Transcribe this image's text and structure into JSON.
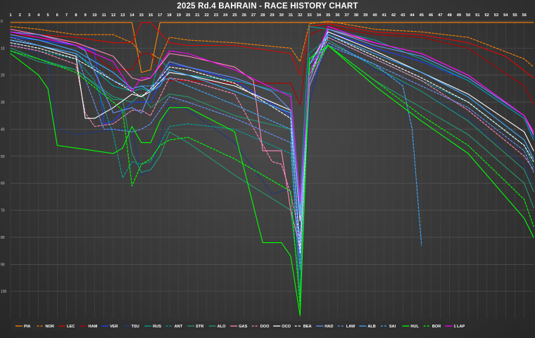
{
  "page": {
    "title": "2025 Rd.4 BAHRAIN - RACE HISTORY CHART"
  },
  "chart_data": {
    "type": "line",
    "title": "2025 Rd.4 BAHRAIN - RACE HISTORY CHART",
    "xlabel": "",
    "ylabel": "",
    "x_ticks": [
      1,
      2,
      3,
      4,
      5,
      6,
      7,
      8,
      9,
      10,
      11,
      12,
      13,
      14,
      15,
      16,
      17,
      18,
      19,
      20,
      21,
      22,
      23,
      24,
      25,
      26,
      27,
      28,
      29,
      30,
      31,
      32,
      33,
      34,
      35,
      36,
      37,
      38,
      39,
      40,
      41,
      42,
      43,
      44,
      45,
      46,
      47,
      48,
      49,
      50,
      51,
      52,
      53,
      54,
      55,
      56
    ],
    "xlim": [
      1,
      57
    ],
    "ylim": [
      0,
      110
    ],
    "y_ticks": [
      0,
      10,
      20,
      30,
      40,
      50,
      60,
      70,
      80,
      90,
      100
    ],
    "y_tick_labels": [
      "0",
      "10",
      "20",
      "30",
      "40",
      "50",
      "60",
      "70",
      "80",
      "90",
      "100"
    ],
    "grid": true,
    "legend_position": "bottom",
    "series": [
      {
        "name": "PIA",
        "color": "#ff8000",
        "dash": "solid",
        "x": [
          1,
          4,
          8,
          12,
          13,
          14,
          15,
          16,
          17,
          18,
          20,
          25,
          31,
          32,
          33,
          35,
          40,
          45,
          50,
          56,
          57
        ],
        "y": [
          0.5,
          0.5,
          0.5,
          0.5,
          0.5,
          0.5,
          19,
          18,
          0.5,
          0.5,
          0.5,
          0.5,
          0.5,
          0.5,
          0.5,
          0.5,
          0.5,
          0.5,
          0.5,
          0.5,
          0.5
        ]
      },
      {
        "name": "NOR",
        "color": "#ff8000",
        "dash": "dash",
        "x": [
          1,
          4,
          8,
          12,
          14,
          15,
          16,
          17,
          18,
          20,
          25,
          31,
          32,
          33,
          35,
          40,
          45,
          50,
          56,
          57
        ],
        "y": [
          2,
          3,
          5,
          5,
          8,
          12,
          12,
          14,
          6,
          7,
          8,
          10,
          15,
          1,
          0,
          3,
          4,
          6,
          14,
          17
        ]
      },
      {
        "name": "LEC",
        "color": "#e10600",
        "dash": "solid",
        "x": [
          1,
          4,
          8,
          12,
          14,
          15,
          16,
          18,
          20,
          25,
          31,
          32,
          33,
          35,
          40,
          45,
          50,
          54,
          57
        ],
        "y": [
          3,
          5,
          6,
          8,
          8,
          0.5,
          0.5,
          8,
          9,
          9,
          12,
          20,
          2,
          1,
          4,
          5,
          8,
          13,
          21
        ]
      },
      {
        "name": "HAM",
        "color": "#b00000",
        "dash": "solid",
        "x": [
          1,
          4,
          8,
          12,
          14,
          15,
          16,
          18,
          20,
          25,
          31,
          32,
          33,
          35,
          40,
          45,
          50,
          56,
          57
        ],
        "y": [
          5,
          6,
          8,
          18,
          18,
          12,
          12,
          22,
          22,
          23,
          23,
          31,
          5,
          2,
          5,
          6,
          10,
          24,
          31
        ]
      },
      {
        "name": "VER",
        "color": "#1e41ff",
        "dash": "solid",
        "x": [
          1,
          4,
          8,
          9,
          10,
          11,
          12,
          14,
          15,
          16,
          18,
          20,
          25,
          31,
          32,
          33,
          35,
          40,
          45,
          50,
          56,
          57
        ],
        "y": [
          6,
          7,
          9,
          10,
          11,
          38,
          37,
          30,
          30,
          30,
          16,
          17,
          22,
          35,
          90,
          30,
          4,
          10,
          15,
          22,
          36,
          43
        ]
      },
      {
        "name": "TSU",
        "color": "#20397a",
        "dash": "solid",
        "x": [
          1,
          4,
          5,
          6,
          8,
          12,
          14,
          15,
          16,
          17,
          18,
          20,
          25,
          29,
          30,
          31,
          32,
          33,
          35,
          40,
          45,
          50,
          56,
          57
        ],
        "y": [
          8,
          12,
          15,
          40,
          42,
          40,
          40,
          57,
          55,
          44,
          30,
          33,
          45,
          64,
          63,
          62,
          96,
          30,
          5,
          18,
          26,
          36,
          53,
          61
        ]
      },
      {
        "name": "RUS",
        "color": "#00a19c",
        "dash": "solid",
        "x": [
          1,
          4,
          8,
          12,
          14,
          15,
          16,
          17,
          18,
          20,
          25,
          31,
          32,
          33,
          35,
          40,
          45,
          50,
          56,
          57
        ],
        "y": [
          7,
          9,
          12,
          24,
          26,
          25,
          26,
          14,
          18,
          20,
          22,
          27,
          66,
          2,
          3,
          7,
          14,
          22,
          36,
          44
        ]
      },
      {
        "name": "ANT",
        "color": "#00a19c",
        "dash": "dash",
        "x": [
          1,
          4,
          8,
          10,
          12,
          13,
          14,
          15,
          16,
          18,
          20,
          25,
          31,
          32,
          33,
          35,
          40,
          45,
          50,
          56,
          57
        ],
        "y": [
          9,
          11,
          14,
          22,
          42,
          58,
          52,
          53,
          52,
          39,
          38,
          40,
          49,
          92,
          12,
          6,
          14,
          22,
          30,
          46,
          54
        ]
      },
      {
        "name": "STR",
        "color": "#229971",
        "dash": "solid",
        "x": [
          1,
          4,
          8,
          12,
          13,
          14,
          15,
          16,
          17,
          18,
          20,
          25,
          31,
          32,
          33,
          35,
          40,
          45,
          50,
          56,
          57
        ],
        "y": [
          10,
          14,
          18,
          29,
          29,
          49,
          56,
          55,
          50,
          41,
          45,
          57,
          70,
          100,
          14,
          7,
          17,
          26,
          37,
          55,
          63
        ]
      },
      {
        "name": "ALO",
        "color": "#229971",
        "dash": "solid",
        "x": [
          1,
          4,
          8,
          12,
          14,
          15,
          16,
          18,
          20,
          25,
          31,
          32,
          33,
          35,
          40,
          45,
          50,
          56,
          57
        ],
        "y": [
          11,
          15,
          18,
          28,
          30,
          27,
          32,
          27,
          28,
          35,
          40,
          104,
          18,
          9,
          22,
          32,
          42,
          60,
          69
        ]
      },
      {
        "name": "GAS",
        "color": "#ff87bc",
        "dash": "solid",
        "x": [
          1,
          4,
          8,
          12,
          14,
          15,
          16,
          18,
          20,
          25,
          27,
          28,
          29,
          30,
          31,
          32,
          33,
          35,
          40,
          45,
          50,
          56,
          57
        ],
        "y": [
          3,
          5,
          8,
          13,
          21,
          22,
          21,
          12,
          13,
          17,
          22,
          48,
          48,
          48,
          70,
          84,
          22,
          3,
          8,
          12,
          20,
          35,
          42
        ]
      },
      {
        "name": "DOO",
        "color": "#ff87bc",
        "dash": "dash",
        "x": [
          1,
          4,
          8,
          9,
          10,
          12,
          14,
          15,
          16,
          18,
          20,
          25,
          29,
          30,
          31,
          32,
          33,
          35,
          40,
          45,
          50,
          56,
          57
        ],
        "y": [
          9,
          11,
          16,
          34,
          39,
          38,
          33,
          33,
          35,
          21,
          22,
          27,
          52,
          53,
          64,
          80,
          24,
          6,
          14,
          22,
          33,
          50,
          55
        ]
      },
      {
        "name": "OCO",
        "color": "#ffffff",
        "dash": "solid",
        "x": [
          1,
          4,
          8,
          9,
          10,
          12,
          14,
          15,
          16,
          18,
          20,
          25,
          31,
          32,
          33,
          35,
          40,
          45,
          50,
          56,
          57
        ],
        "y": [
          7,
          9,
          13,
          36,
          36,
          32,
          27,
          28,
          26,
          19,
          20,
          24,
          33,
          74,
          16,
          4,
          11,
          19,
          27,
          41,
          48
        ]
      },
      {
        "name": "BEA",
        "color": "#ffffff",
        "dash": "dash",
        "x": [
          1,
          4,
          8,
          12,
          14,
          15,
          16,
          18,
          20,
          25,
          31,
          32,
          33,
          35,
          40,
          45,
          50,
          56,
          57
        ],
        "y": [
          8,
          10,
          14,
          22,
          26,
          28,
          25,
          17,
          18,
          23,
          36,
          86,
          20,
          5,
          13,
          21,
          30,
          46,
          52
        ]
      },
      {
        "name": "HAD",
        "color": "#6692ff",
        "dash": "solid",
        "x": [
          1,
          4,
          8,
          9,
          12,
          14,
          15,
          16,
          18,
          20,
          25,
          29,
          31,
          32,
          33,
          35,
          40,
          45,
          50,
          56,
          57
        ],
        "y": [
          4,
          5,
          9,
          11,
          34,
          32,
          34,
          26,
          15,
          17,
          21,
          26,
          33,
          70,
          22,
          3,
          9,
          13,
          21,
          35,
          41
        ]
      },
      {
        "name": "LAW",
        "color": "#6692ff",
        "dash": "dash",
        "x": [
          1,
          4,
          8,
          11,
          12,
          14,
          15,
          16,
          18,
          20,
          25,
          31,
          32,
          33,
          35,
          40,
          45,
          50,
          56,
          57
        ],
        "y": [
          6,
          9,
          12,
          40,
          40,
          41,
          40,
          38,
          28,
          30,
          36,
          45,
          92,
          24,
          8,
          16,
          24,
          32,
          48,
          56
        ]
      },
      {
        "name": "ALB",
        "color": "#3fa9ff",
        "dash": "solid",
        "x": [
          1,
          4,
          8,
          12,
          14,
          15,
          16,
          17,
          18,
          20,
          25,
          31,
          32,
          33,
          35,
          40,
          45,
          50,
          56,
          57
        ],
        "y": [
          5,
          7,
          11,
          19,
          25,
          24,
          26,
          24,
          18,
          20,
          26,
          34,
          72,
          16,
          5,
          12,
          19,
          28,
          44,
          51
        ]
      },
      {
        "name": "SAI",
        "color": "#3fa9ff",
        "dash": "dash",
        "x": [
          1,
          4,
          8,
          12,
          14,
          15,
          16,
          18,
          20,
          25,
          31,
          32,
          33,
          35,
          40,
          43,
          44,
          45
        ],
        "y": [
          7,
          9,
          12,
          22,
          25,
          24,
          24,
          21,
          24,
          31,
          40,
          82,
          16,
          9,
          16,
          24,
          40,
          83
        ]
      },
      {
        "name": "HUL",
        "color": "#00ff00",
        "dash": "solid",
        "x": [
          1,
          4,
          5,
          6,
          8,
          12,
          13,
          14,
          15,
          16,
          17,
          18,
          20,
          25,
          28,
          29,
          30,
          31,
          32,
          33,
          35,
          40,
          45,
          50,
          56,
          57
        ],
        "y": [
          12,
          20,
          25,
          46,
          47,
          49,
          47,
          39,
          45,
          45,
          37,
          32,
          32,
          41,
          82,
          82,
          82,
          87,
          109,
          14,
          9,
          24,
          37,
          49,
          73,
          80
        ]
      },
      {
        "name": "BOR",
        "color": "#00ff00",
        "dash": "dash",
        "x": [
          1,
          4,
          8,
          12,
          13,
          14,
          15,
          16,
          17,
          18,
          20,
          25,
          31,
          32,
          33,
          35,
          40,
          45,
          50,
          56,
          57
        ],
        "y": [
          11,
          14,
          19,
          30,
          33,
          61,
          53,
          51,
          46,
          44,
          43,
          51,
          63,
          106,
          20,
          9,
          22,
          35,
          46,
          66,
          76
        ]
      },
      {
        "name": "1 LAP",
        "color": "#ff00ff",
        "dash": "solid",
        "x": [
          1,
          4,
          8,
          12,
          14,
          15,
          16,
          18,
          20,
          25,
          31,
          32,
          33,
          35,
          40,
          45,
          50,
          56,
          57
        ],
        "y": [
          4,
          6,
          9,
          15,
          26,
          21,
          21,
          11,
          12,
          18,
          28,
          67,
          20,
          2,
          8,
          12,
          20,
          35,
          41
        ]
      }
    ]
  }
}
